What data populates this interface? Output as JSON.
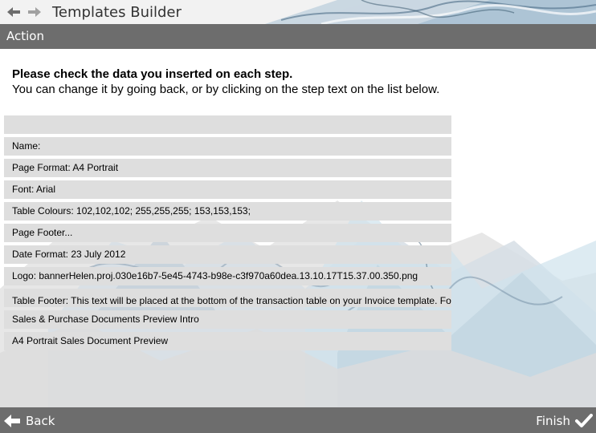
{
  "header": {
    "app_title": "Templates Builder"
  },
  "section": {
    "title": "Action"
  },
  "instructions": {
    "title": "Please check the data you inserted on each step.",
    "subtitle": "You can change it by going back, or by clicking on the step text on the list below."
  },
  "steps": [
    "Name:",
    "Page Format: A4 Portrait",
    "Font: Arial",
    "Table Colours: 102,102,102; 255,255,255; 153,153,153;",
    "Page Footer...",
    "Date Format: 23 July 2012",
    "Logo: bannerHelen.proj.030e16b7-5e45-4743-b98e-c3f970a60dea.13.10.17T15.37.00.350.png",
    "Table Footer: This text will be placed at the bottom of the transaction table on your Invoice template. Fo Custom Credit Note and Purchase Order templates you will need to edit the text",
    "Sales & Purchase Documents Preview Intro",
    "A4 Portrait Sales Document Preview"
  ],
  "footer": {
    "back_label": "Back",
    "finish_label": "Finish"
  },
  "colors": {
    "bar": "#6d6d6d",
    "step_bg": "#dedede"
  }
}
